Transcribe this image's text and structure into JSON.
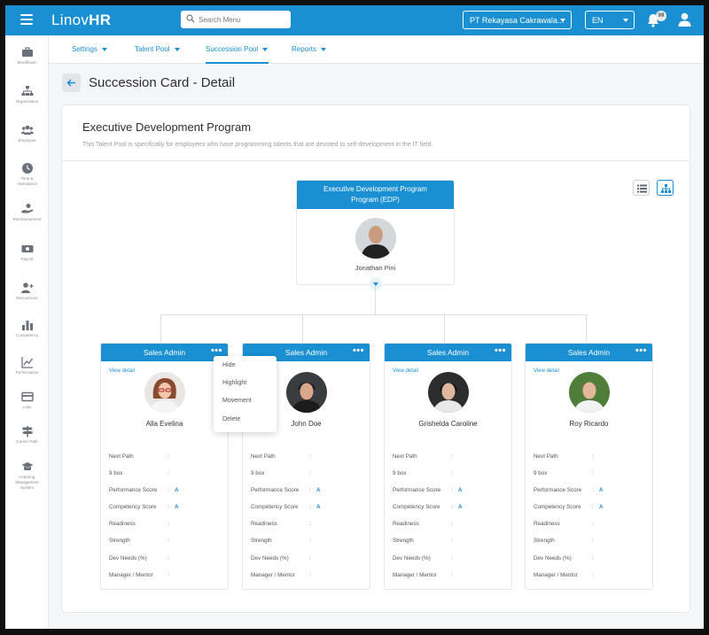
{
  "app": {
    "logo_text": "Linov",
    "logo_bold": "HR",
    "brand_color": "#1a8fd1"
  },
  "search": {
    "placeholder": "Search Menu"
  },
  "header": {
    "company": "PT Rekayasa Cakrawala...",
    "language": "EN",
    "notification_count": "99"
  },
  "sidebar": {
    "items": [
      {
        "label": "Workflowm",
        "icon": "briefcase-icon"
      },
      {
        "label": "Organization",
        "icon": "org-chart-icon"
      },
      {
        "label": "Employee",
        "icon": "users-icon"
      },
      {
        "label": "Time & Attendance",
        "icon": "clock-icon"
      },
      {
        "label": "Reimbursement",
        "icon": "hand-coin-icon"
      },
      {
        "label": "Payroll",
        "icon": "money-icon"
      },
      {
        "label": "Recruitment",
        "icon": "user-plus-icon"
      },
      {
        "label": "Competency",
        "icon": "bar-chart-icon"
      },
      {
        "label": "Performance",
        "icon": "line-chart-icon"
      },
      {
        "label": "Loan",
        "icon": "card-icon"
      },
      {
        "label": "Career Path",
        "icon": "signpost-icon"
      },
      {
        "label": "Learning Management System",
        "icon": "graduation-cap-icon"
      }
    ]
  },
  "subnav": {
    "tabs": [
      {
        "label": "Settings"
      },
      {
        "label": "Talent Pool"
      },
      {
        "label": "Succession Pool"
      },
      {
        "label": "Reports"
      }
    ],
    "active": "Succession Pool"
  },
  "page": {
    "title": "Succession Card - Detail"
  },
  "program": {
    "title": "Executive Development Program",
    "description": "This Talent Pool is specifically for employees who have programming talents that are devoted to self-development in the IT field."
  },
  "root": {
    "title_line1": "Executive Development Program",
    "title_line2": "Program (EDP)",
    "name": "Jonathan Pini"
  },
  "labels": {
    "view_detail": "View detail",
    "attributes": [
      "Next Path",
      "9 box",
      "Performance Score",
      "Competency Score",
      "Readiness",
      "Strength",
      "Dev Needs (%)",
      "Manager / Mentor"
    ],
    "colon": ":"
  },
  "nodes": [
    {
      "title": "Sales Admin",
      "name": "Alla Evelina",
      "performance": "A",
      "competency": "A"
    },
    {
      "title": "Sales Admin",
      "name": "John Doe",
      "performance": "A",
      "competency": "A"
    },
    {
      "title": "Sales Admin",
      "name": "Grishelda Caroline",
      "performance": "A",
      "competency": "A"
    },
    {
      "title": "Sales Admin",
      "name": "Roy Ricardo",
      "performance": "A",
      "competency": "A"
    }
  ],
  "menu": {
    "items": [
      "Hide",
      "Highlight",
      "Movement",
      "Delete"
    ]
  }
}
